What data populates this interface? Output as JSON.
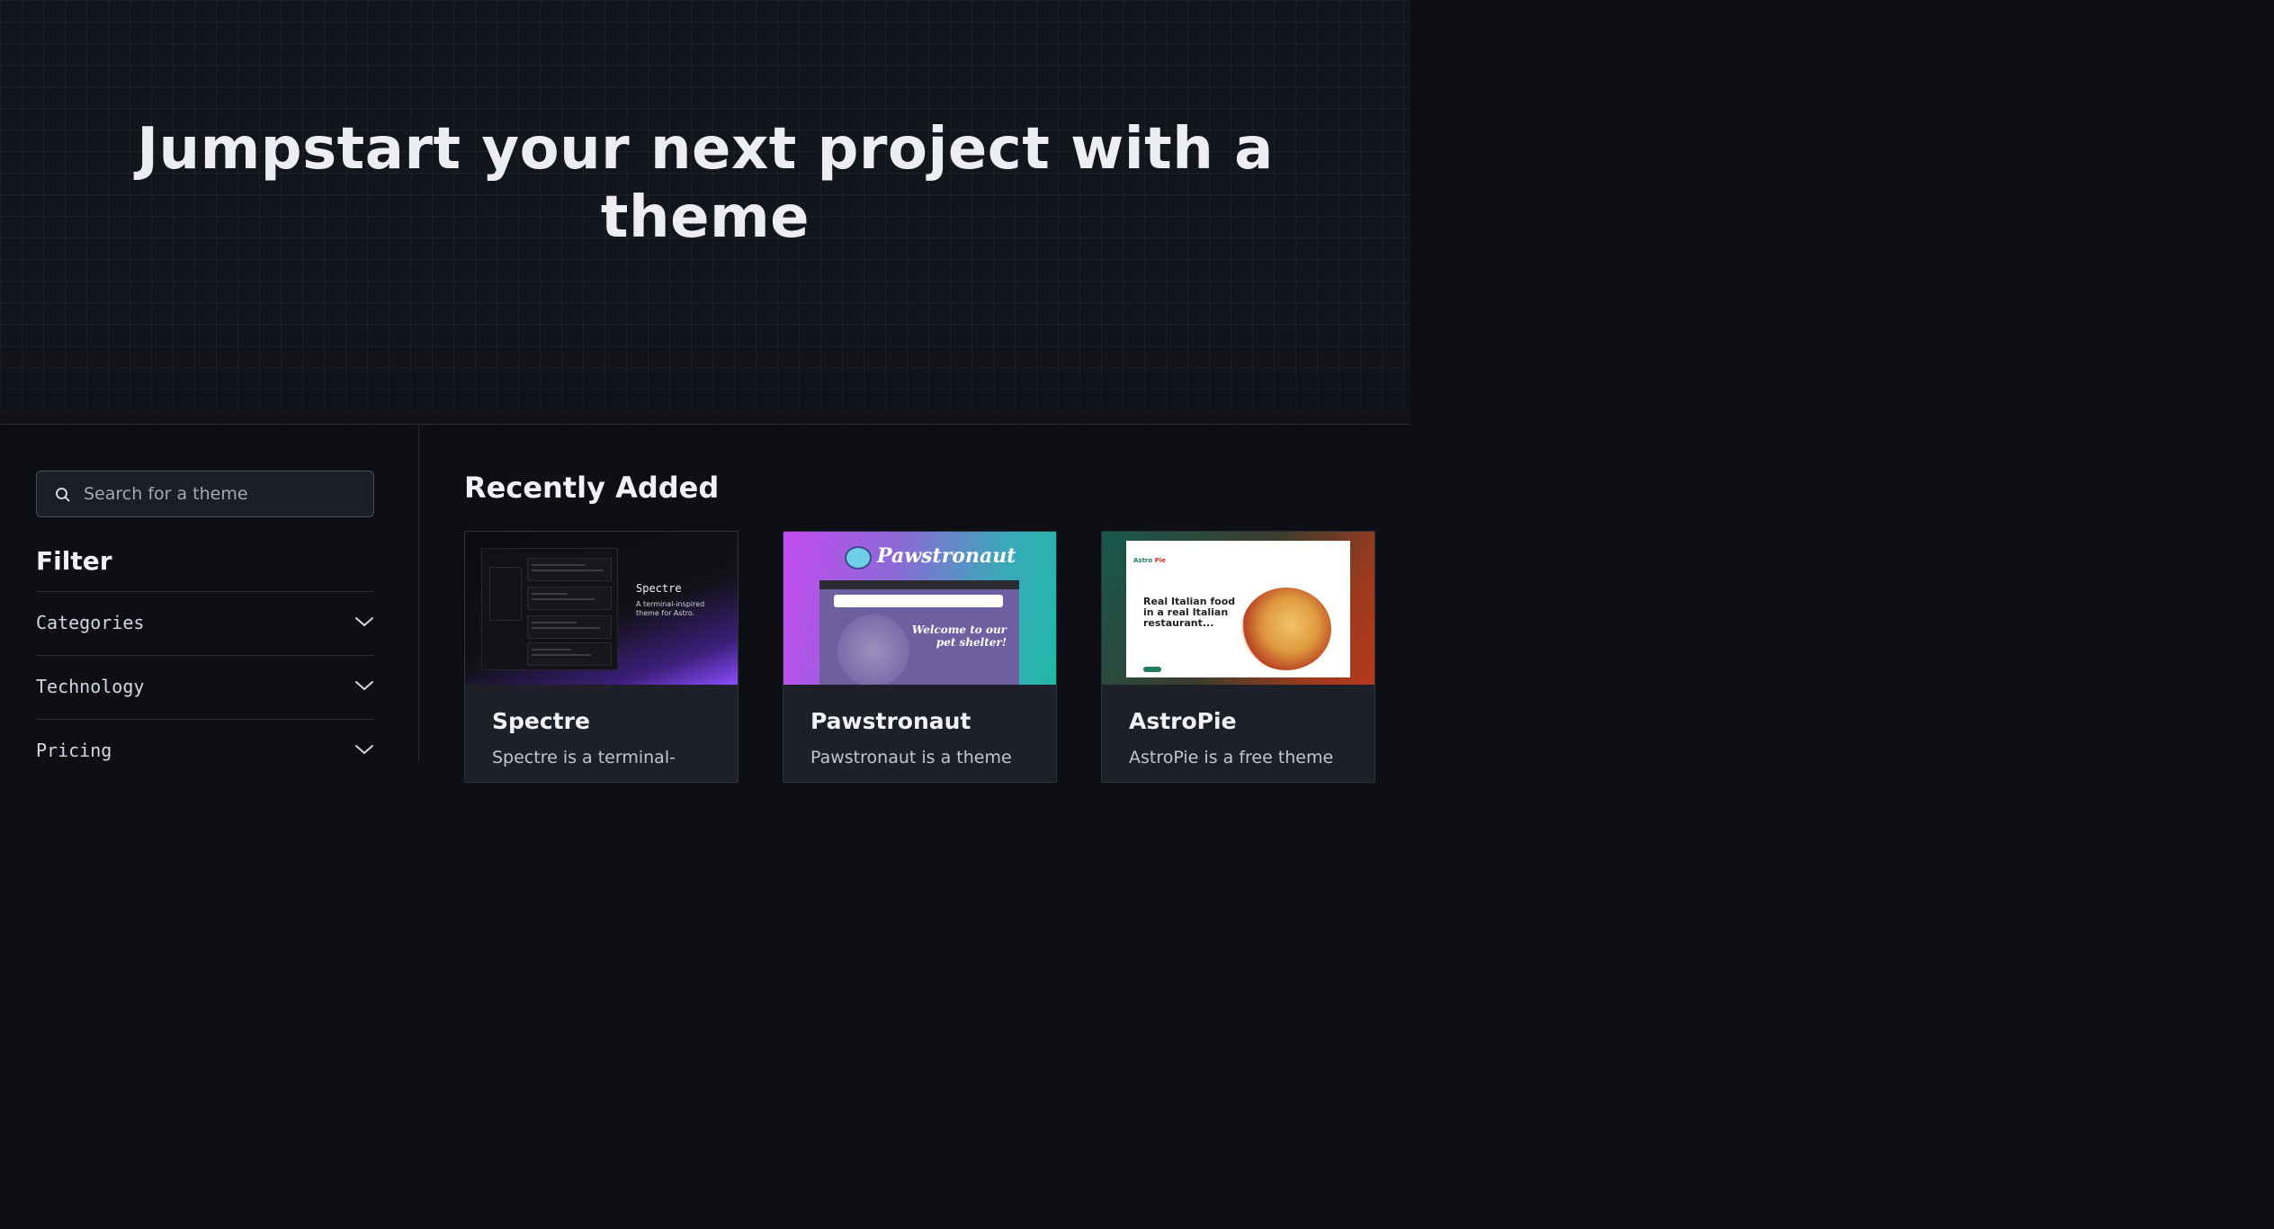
{
  "hero": {
    "title": "Jumpstart your next project with a theme"
  },
  "sidebar": {
    "search": {
      "placeholder": "Search for a theme",
      "value": ""
    },
    "filter_title": "Filter",
    "filters": [
      {
        "label": "Categories"
      },
      {
        "label": "Technology"
      },
      {
        "label": "Pricing"
      }
    ]
  },
  "main": {
    "section_title": "Recently Added",
    "cards": [
      {
        "name": "Spectre",
        "description": "Spectre is a terminal-",
        "thumb_title": "Spectre",
        "thumb_subtitle": "A terminal-inspired theme for Astro."
      },
      {
        "name": "Pawstronaut",
        "description": "Pawstronaut is a theme",
        "thumb_title": "Pawstronaut",
        "thumb_hero": "Welcome to our pet shelter!"
      },
      {
        "name": "AstroPie",
        "description": "AstroPie is a free theme",
        "thumb_logo_a": "Astro",
        "thumb_logo_b": "Pie",
        "thumb_heading": "Real Italian food in a real Italian restaurant..."
      }
    ]
  },
  "colors": {
    "background": "#0d0f15",
    "card": "#1d2029",
    "border": "#2a2d37"
  }
}
